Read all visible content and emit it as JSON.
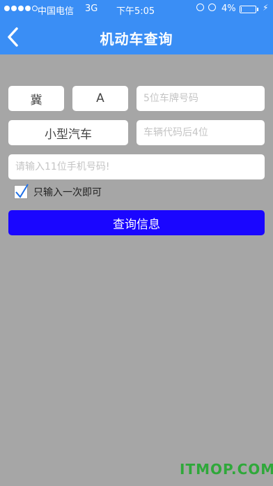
{
  "status_bar": {
    "carrier": "中国电信",
    "network": "3G",
    "time": "下午5:05",
    "battery_percent": "4%",
    "battery_level": 0.04,
    "icons": [
      "signal-icon",
      "orientation-lock-icon",
      "alarm-icon",
      "battery-icon",
      "charging-icon"
    ]
  },
  "nav": {
    "back_icon": "chevron-left-icon",
    "title": "机动车查询"
  },
  "form": {
    "province": "冀",
    "letter": "A",
    "plate_placeholder": "5位车牌号码",
    "vehicle_type": "小型汽车",
    "code_placeholder": "车辆代码后4位",
    "phone_placeholder": "请输入11位手机号码!",
    "remember_checked": true,
    "remember_label": "只输入一次即可",
    "submit_label": "查询信息"
  },
  "watermark": "ITMOP.COM",
  "colors": {
    "header": "#3a8ef5",
    "background": "#a6a6a6",
    "submit": "#1a06ff",
    "watermark": "#2fa83a"
  }
}
